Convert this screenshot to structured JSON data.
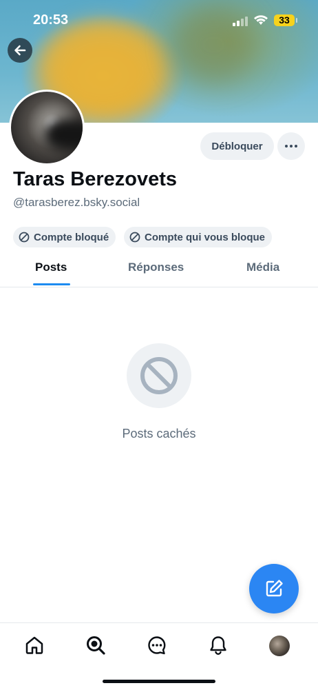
{
  "status_bar": {
    "time": "20:53",
    "battery": "33"
  },
  "profile": {
    "display_name": "Taras Berezovets",
    "handle": "@tarasberez.bsky.social",
    "unblock_label": "Débloquer",
    "badges": [
      "Compte bloqué",
      "Compte qui vous bloque"
    ]
  },
  "tabs": [
    {
      "label": "Posts",
      "active": true
    },
    {
      "label": "Réponses",
      "active": false
    },
    {
      "label": "Média",
      "active": false
    }
  ],
  "empty_state": {
    "message": "Posts cachés",
    "icon": "block-icon"
  },
  "colors": {
    "accent": "#1d8bf0",
    "fab": "#2b86f3",
    "muted": "#5c6b7a"
  },
  "bottom_nav": [
    "home-icon",
    "search-icon",
    "chat-icon",
    "bell-icon",
    "profile-avatar"
  ]
}
